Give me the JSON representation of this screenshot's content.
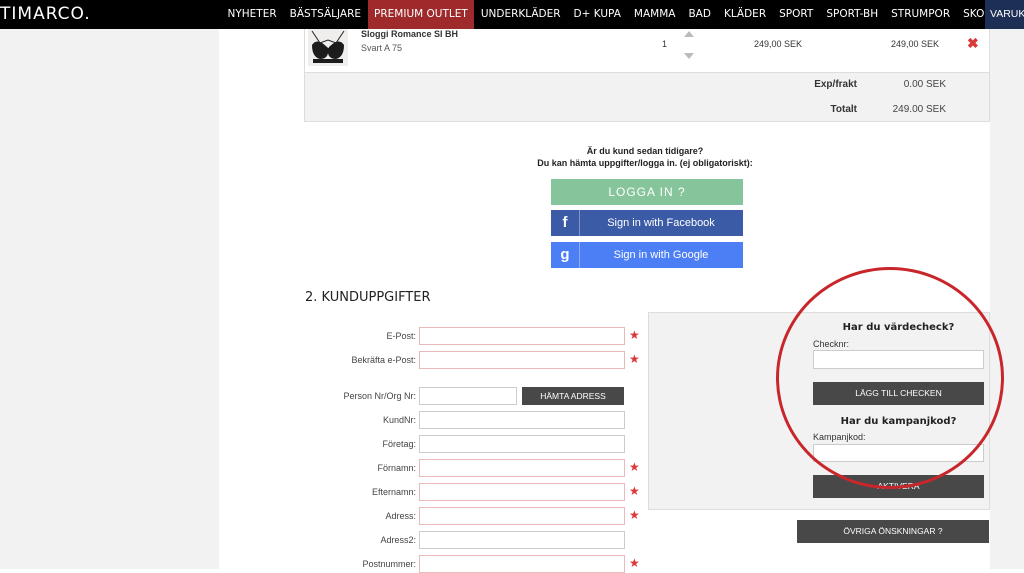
{
  "brand": {
    "logo": "TIMARCO."
  },
  "nav": {
    "items": [
      "NYHETER",
      "BÄSTSÄLJARE",
      "PREMIUM OUTLET",
      "UNDERKLÄDER",
      "D+ KUPA",
      "MAMMA",
      "BAD",
      "KLÄDER",
      "SPORT",
      "SPORT-BH",
      "STRUMPOR",
      "SKOR"
    ],
    "active": "PREMIUM OUTLET",
    "cart_tab": "VARUKORG"
  },
  "cart": {
    "product_name": "Sloggi Romance SI BH",
    "variant": "Svart A 75",
    "quantity": "1",
    "unit_price": "249,00 SEK",
    "line_total": "249,00 SEK",
    "remove_icon": "✖",
    "shipping_label": "Exp/frakt",
    "shipping_value": "0.00 SEK",
    "total_label": "Totalt",
    "total_value": "249.00 SEK"
  },
  "login": {
    "question": "Är du kund sedan tidigare?",
    "hint": "Du kan hämta uppgifter/logga in. (ej obligatoriskt):",
    "login_button": "LOGGA IN ?",
    "facebook_button": "Sign in with Facebook",
    "google_button": "Sign in with Google",
    "facebook_icon": "f",
    "google_icon": "g"
  },
  "form": {
    "title": "2. KUNDUPPGIFTER",
    "email_label": "E-Post:",
    "confirm_email_label": "Bekräfta e-Post:",
    "person_nr_label": "Person Nr/Org Nr:",
    "fetch_address_button": "HÄMTA ADRESS",
    "kundnr_label": "KundNr:",
    "company_label": "Företag:",
    "firstname_label": "Förnamn:",
    "lastname_label": "Efternamn:",
    "address_label": "Adress:",
    "address2_label": "Adress2:",
    "postcode_label": "Postnummer:",
    "required_mark": "★"
  },
  "voucher": {
    "title": "Har du värdecheck?",
    "check_label": "Checknr:",
    "add_button": "LÄGG TILL CHECKEN",
    "campaign_title": "Har du kampanjkod?",
    "campaign_label": "Kampanjkod:",
    "activate_button": "AKTIVERA",
    "other_wishes_button": "ÖVRIGA ÖNSKNINGAR ?"
  },
  "colors": {
    "nav_active": "#9e2a2b",
    "login_button": "#86c49b",
    "facebook": "#3b5ba6",
    "google": "#4c7ef5",
    "highlight_circle": "#c8262b"
  }
}
